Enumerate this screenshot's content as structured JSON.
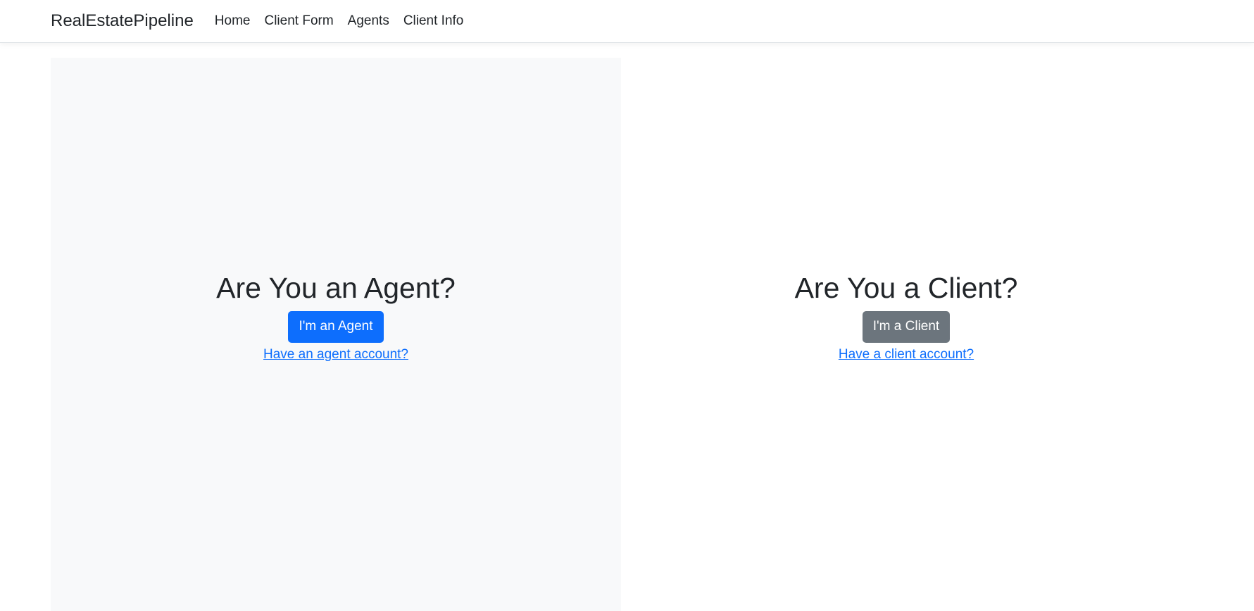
{
  "navbar": {
    "brand": "RealEstatePipeline",
    "links": [
      {
        "label": "Home"
      },
      {
        "label": "Client Form"
      },
      {
        "label": "Agents"
      },
      {
        "label": "Client Info"
      }
    ]
  },
  "agent_panel": {
    "title": "Are You an Agent?",
    "button_label": "I'm an Agent",
    "link_label": "Have an agent account?"
  },
  "client_panel": {
    "title": "Are You a Client?",
    "button_label": "I'm a Client",
    "link_label": "Have a client account?"
  },
  "colors": {
    "primary": "#0d6efd",
    "secondary": "#6c757d",
    "light_panel": "#f8f9fa"
  }
}
